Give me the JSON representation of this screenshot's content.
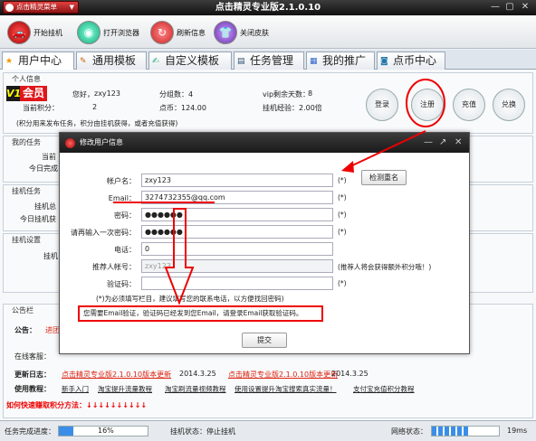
{
  "titlebar": {
    "menu_label": "点击精灵菜单",
    "title": "点击精灵专业版2.1.0.10"
  },
  "toolbar": {
    "buttons": [
      {
        "label": "开始挂机",
        "icon": "car-icon"
      },
      {
        "label": "打开浏览器",
        "icon": "globe-icon"
      },
      {
        "label": "刷新信息",
        "icon": "refresh-icon"
      },
      {
        "label": "关闭皮肤",
        "icon": "shirt-icon"
      }
    ]
  },
  "tabs": [
    "用户中心",
    "通用模板",
    "自定义模板",
    "任务管理",
    "我的推广",
    "点币中心"
  ],
  "user_info": {
    "group_title": "个人信息",
    "vip_badge": "V1",
    "member_label": "会员",
    "greeting": "您好，",
    "username": "zxy123",
    "group_label": "分组数：4",
    "vip_days_label": "vip剩余天数：",
    "vip_days": "8",
    "points_label": "当前积分：",
    "points_value": "2",
    "coins_label": "点币：124.00",
    "hangup_exp_label": "挂机经验：2.00倍",
    "note": "(积分用来发布任务，积分由挂机获得，或者充值获得)",
    "buttons": [
      "登录",
      "注册",
      "充值",
      "兑换"
    ]
  },
  "task_group": {
    "title": "我的任务",
    "row1": "当前",
    "row2": "今日完成"
  },
  "hangup_task": {
    "title": "挂机任务",
    "row1": "挂机总",
    "row2": "今日挂机获"
  },
  "hangup_settings": {
    "title": "挂机设置",
    "row1": "挂机"
  },
  "notice": {
    "title": "公告栏",
    "announce_label": "公告：",
    "announce_link": "进团",
    "online_label": "在线客服：",
    "update_label": "更新日志：",
    "update_link1": "点击精灵专业版2.1.0.10版本更新",
    "update_date1": "2014.3.25",
    "update_link2": "点击精灵专业版2.1.0.10版本更新",
    "update_date2": "2014.3.25",
    "tutorial_label": "使用教程：",
    "tutorial_links": [
      "新手入门",
      "淘宝提升流量教程",
      "淘宝刷流量视频教程",
      "使用设置提升淘宝搜索真实流量！",
      "支付宝充值积分教程"
    ],
    "earn": "如何快速赚取积分方法：↓↓↓↓↓↓↓↓↓↓"
  },
  "statusbar": {
    "task_progress_label": "任务完成进度：",
    "progress_text": "16%",
    "progress_value": 0.16,
    "hangup_status": "挂机状态：停止挂机",
    "network_label": "网络状态：",
    "network_value": 0.55,
    "latency": "19ms"
  },
  "dialog": {
    "title": "修改用户信息",
    "fields": [
      {
        "label": "帐户名：",
        "value": "zxy123",
        "star": "(*)"
      },
      {
        "label": "Email：",
        "value": "3274732355@qq.com",
        "star": "(*)"
      },
      {
        "label": "密码：",
        "value": "●●●●●●",
        "star": "(*)"
      },
      {
        "label": "请再输入一次密码：",
        "value": "●●●●●●",
        "star": "(*)"
      },
      {
        "label": "电话：",
        "value": "0",
        "star": ""
      },
      {
        "label": "推荐人帐号：",
        "value": "zxy123",
        "star": "(推荐人将会获得额外积分哦！)"
      },
      {
        "label": "验证码：",
        "value": "",
        "star": "(*)"
      }
    ],
    "check_button": "检测重名",
    "hint": "(*)为必须填写栏目，建议填写您的联系电话，以方便找回密码)",
    "verify_msg": "您需要Email验证，验证码已经发到您Email，请登录Email获取验证码。",
    "submit": "提交"
  },
  "colors": {
    "accent_red": "#e0161a",
    "progress_blue": "#3a8ee8"
  }
}
